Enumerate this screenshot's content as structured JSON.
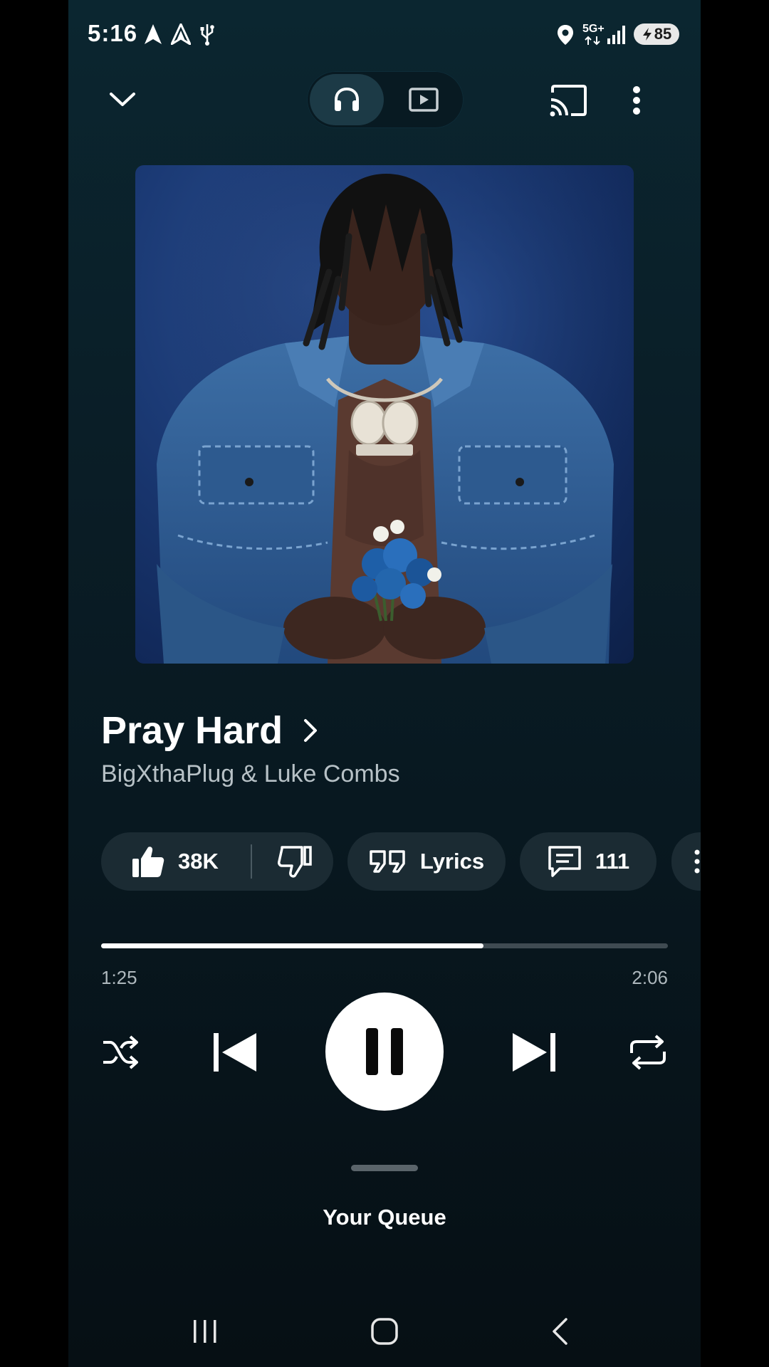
{
  "status_bar": {
    "time": "5:16",
    "network": "5G+",
    "battery": "85"
  },
  "player": {
    "title": "Pray Hard",
    "artist": "BigXthaPlug & Luke Combs",
    "likes": "38K",
    "lyrics_label": "Lyrics",
    "comments": "111",
    "elapsed": "1:25",
    "duration": "2:06",
    "progress_fraction": 0.674
  },
  "queue_label": "Your Queue",
  "icons": {
    "top_left": "chevron-down-icon",
    "mode_audio": "headphones-icon",
    "mode_video": "video-play-icon",
    "cast": "cast-icon",
    "menu": "more-vert-icon",
    "like": "thumbs-up-icon",
    "dislike": "thumbs-down-icon",
    "lyrics": "quote-icon",
    "comments": "comment-icon",
    "shuffle": "shuffle-icon",
    "previous": "skip-previous-icon",
    "pause": "pause-icon",
    "next": "skip-next-icon",
    "repeat": "repeat-icon"
  },
  "colors": {
    "background_top": "#0b2630",
    "background_bottom": "#060f14",
    "chip_background": "#1b2b33",
    "progress_fill": "#ffffff",
    "progress_track": "#3f4b52"
  }
}
